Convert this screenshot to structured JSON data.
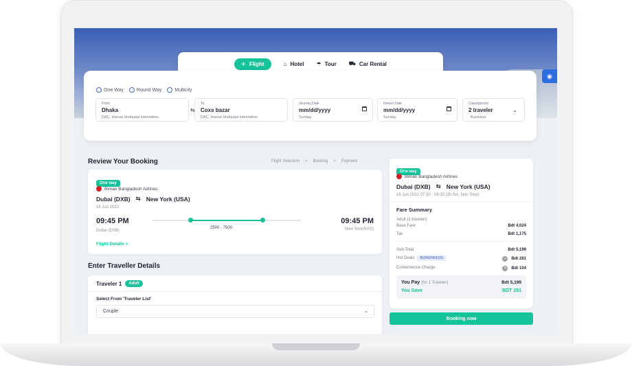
{
  "tabs": [
    {
      "label": "Flight",
      "icon": "plane-icon"
    },
    {
      "label": "Hotel",
      "icon": "bed-icon"
    },
    {
      "label": "Tour",
      "icon": "umbrella-icon"
    },
    {
      "label": "Car Rental",
      "icon": "car-icon"
    }
  ],
  "search": {
    "trip_types": [
      "One Way",
      "Round Way",
      "Multicity"
    ],
    "from": {
      "label": "From",
      "value": "Dhaka",
      "sub": "DAC, Hazrat Shahjalal Internation."
    },
    "to": {
      "label": "To",
      "value": "Coxs bazar",
      "sub": "DAC, Hazrat Shahjalal Internation."
    },
    "journey": {
      "label": "Journey Date",
      "value": "mm/dd/yyyy",
      "sub": "Sunday"
    },
    "return": {
      "label": "Return Date",
      "value": "mm/dd/yyyy",
      "sub": "Sunday"
    },
    "class": {
      "label": "Class/person",
      "value": "2 traveler",
      "sub": "Business"
    }
  },
  "review": {
    "title": "Review Your Booking",
    "breadcrumb": [
      "Flight Selection",
      ">",
      "Booking",
      ">",
      "Payment"
    ]
  },
  "flight": {
    "badge": "One way",
    "airline": "Biman Bangladesh Airlines",
    "from": "Dubai (DXB)",
    "to": "New York (USA)",
    "date": "16 Jun 2022",
    "depart_time": "09:45 PM",
    "depart_place": "Dubai (DXB)",
    "arrive_time": "09:45 PM",
    "arrive_place": "New York(NYC)",
    "range": "2500  - 7500",
    "details_link": "Flight Details  >"
  },
  "traveller": {
    "title": "Enter Traveller Details",
    "name": "Traveler 1",
    "badge": "Adult",
    "select_label": "Select From 'Traveler List'",
    "select_value": "Couple"
  },
  "summary": {
    "badge": "One way",
    "airline": "Biman Bangladesh Airlines",
    "from": "Dubai (DXB)",
    "to": "New York (USA)",
    "info": "16 Jun 2022  07:30 - 08:35 (1h 5m, Non Stop)",
    "fare_title": "Fare Summary",
    "adult": "Adult (1 traveler)",
    "base_fare_label": "Base Fare",
    "base_fare": "Bdt 4,024",
    "tax_label": "Tax",
    "tax": "Bdt 1,175",
    "subtotal_label": "Sub-Total",
    "subtotal": "Bdt 5,199",
    "hot_deals_label": "Hot Deals",
    "promo": "BORENNO25",
    "hot_deals": "Bdt 281",
    "convenience_label": "Convenience Charge",
    "convenience": "Bdt 104",
    "you_pay_label": "You Pay",
    "you_pay_note": "(for 1 Traveler)",
    "you_pay": "Bdt 5,199",
    "you_save_label": "You Save",
    "you_save": "BDT 281",
    "booking_button": "Booking now"
  },
  "colors": {
    "accent": "#15c39a",
    "blue": "#2d6cdf"
  }
}
